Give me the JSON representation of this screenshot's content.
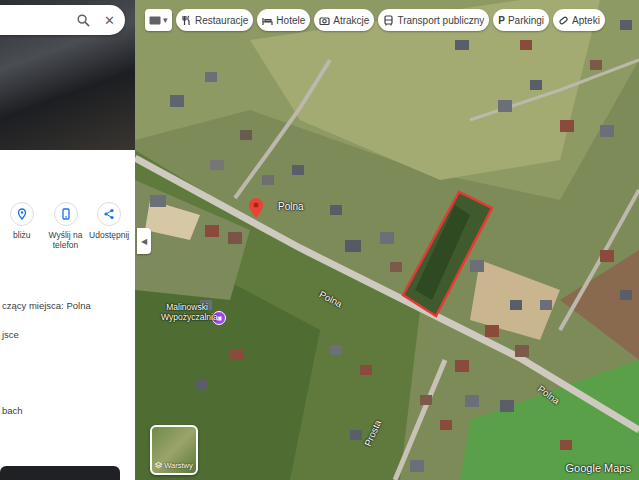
{
  "search": {
    "clear_icon": "✕"
  },
  "actions": [
    {
      "label": "bliżu"
    },
    {
      "label": "Wyślij na telefon"
    },
    {
      "label": "Udostępnij"
    }
  ],
  "details": [
    "czący miejsca: Polna",
    "jsce",
    "bach"
  ],
  "collapse_icon": "◀",
  "map_type": {
    "arrow": "▾"
  },
  "chips": [
    {
      "label": "Restauracje"
    },
    {
      "label": "Hotele"
    },
    {
      "label": "Atrakcje"
    },
    {
      "label": "Transport publiczny"
    },
    {
      "label": "Parkingi",
      "glyph": "P"
    },
    {
      "label": "Apteki"
    }
  ],
  "pin": {
    "label": "Polna"
  },
  "place": {
    "label": "Malinowski Wypożyczalnia"
  },
  "road_labels": [
    {
      "text": "Polna"
    },
    {
      "text": "Polna"
    },
    {
      "text": "Prosta"
    }
  ],
  "layers": {
    "label": "Warstwy"
  },
  "attribution": "Google Maps"
}
